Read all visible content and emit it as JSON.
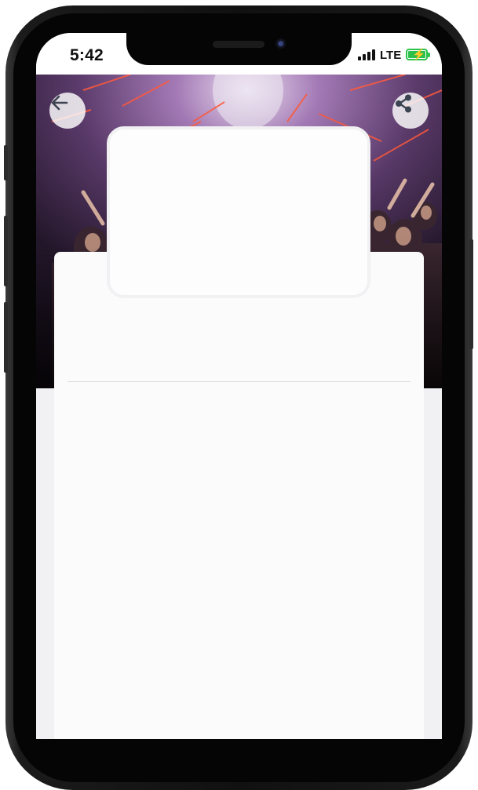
{
  "status_bar": {
    "time": "5:42",
    "network": "LTE",
    "battery_state": "charging",
    "signal_bars": 4
  },
  "header": {
    "back_icon": "arrow-left-icon",
    "share_icon": "share-icon"
  },
  "hero": {
    "image": "concert-crowd-stage-lights",
    "overlay_color": "#5a3a6a"
  },
  "colors": {
    "card": "#fbfbfb",
    "screen_bg": "#f1f1f3",
    "battery": "#2cc14b",
    "icon": "#3d4451"
  }
}
